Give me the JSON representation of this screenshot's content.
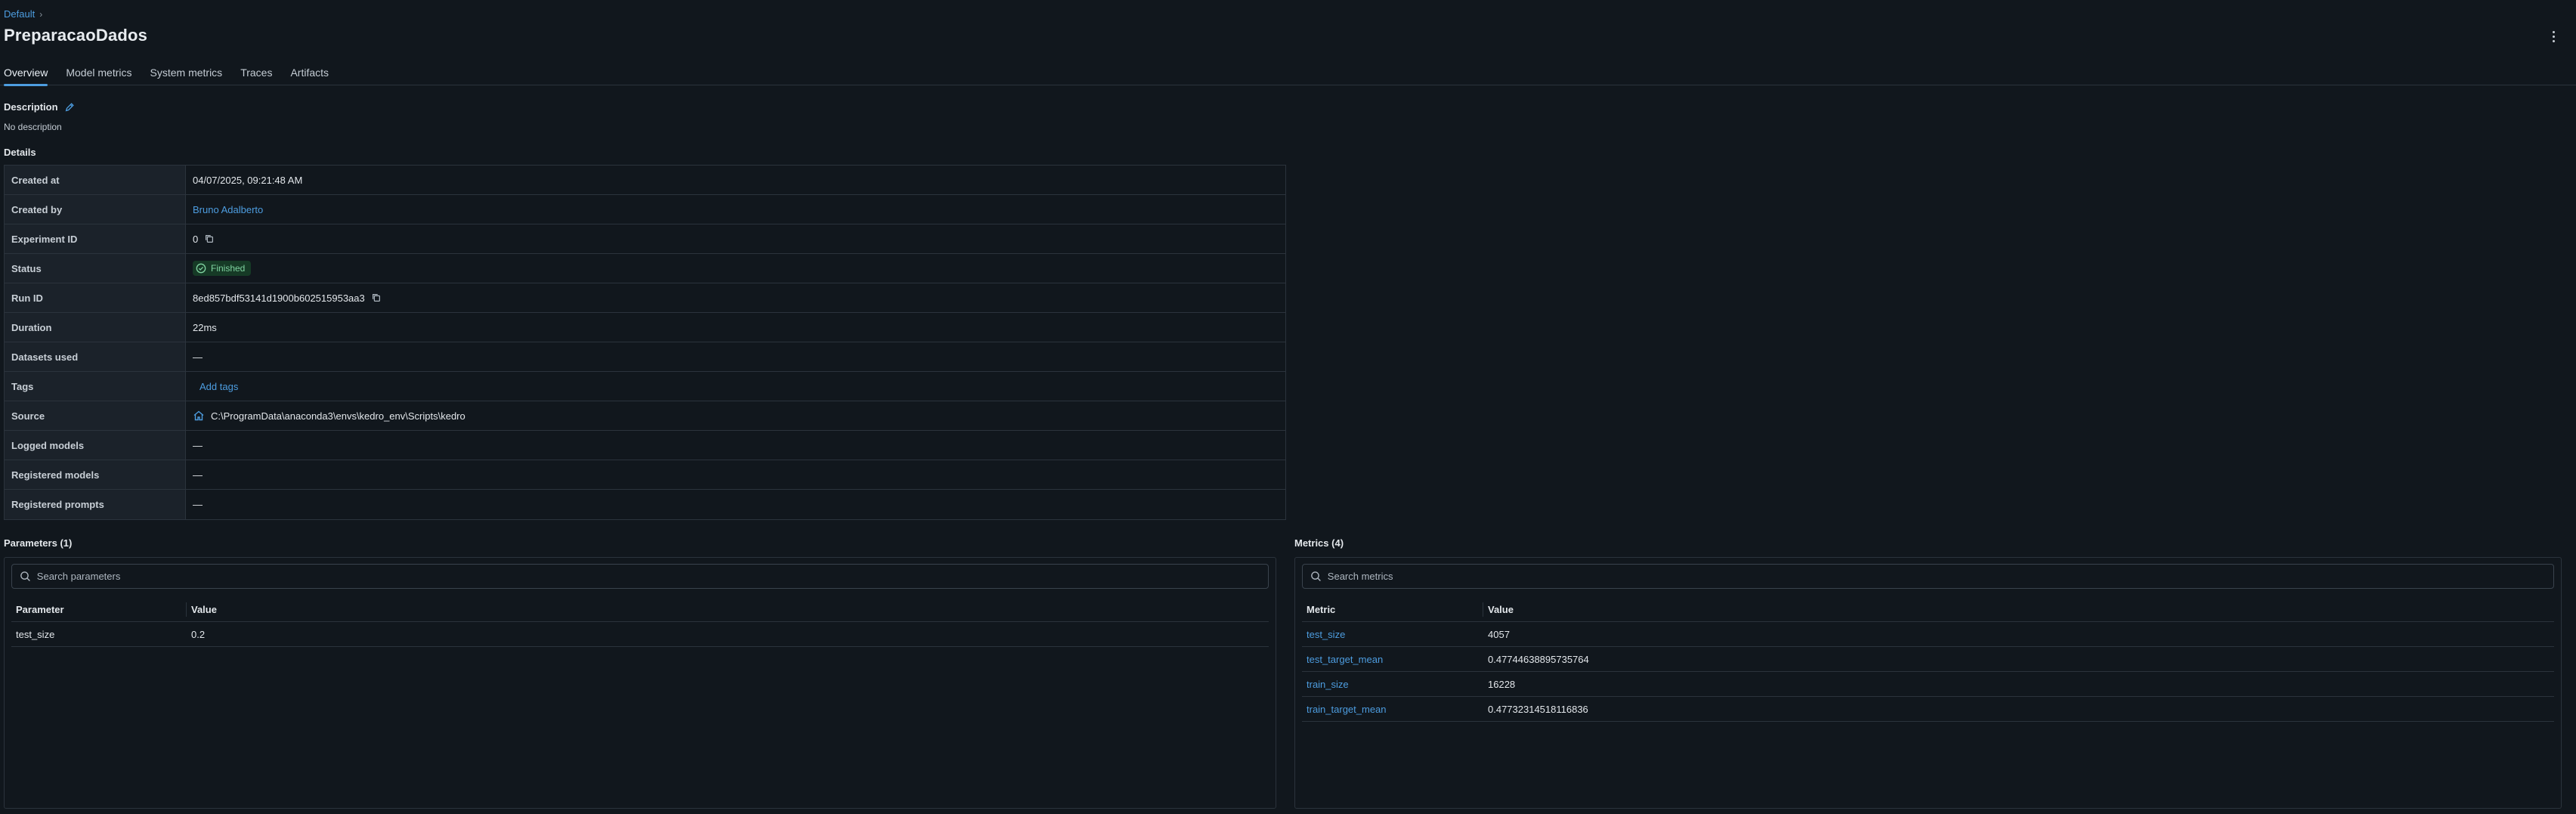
{
  "breadcrumb": {
    "item": "Default",
    "separator": "›"
  },
  "header": {
    "title": "PreparacaoDados"
  },
  "tabs": [
    {
      "label": "Overview",
      "active": true
    },
    {
      "label": "Model metrics",
      "active": false
    },
    {
      "label": "System metrics",
      "active": false
    },
    {
      "label": "Traces",
      "active": false
    },
    {
      "label": "Artifacts",
      "active": false
    }
  ],
  "description": {
    "label": "Description",
    "value": "No description"
  },
  "details": {
    "label": "Details",
    "rows": [
      {
        "key": "Created at",
        "value": "04/07/2025, 09:21:48 AM"
      },
      {
        "key": "Created by",
        "value": "Bruno Adalberto"
      },
      {
        "key": "Experiment ID",
        "value": "0"
      },
      {
        "key": "Status",
        "value": "Finished"
      },
      {
        "key": "Run ID",
        "value": "8ed857bdf53141d1900b602515953aa3"
      },
      {
        "key": "Duration",
        "value": "22ms"
      },
      {
        "key": "Datasets used",
        "value": "—"
      },
      {
        "key": "Tags",
        "value": "Add tags"
      },
      {
        "key": "Source",
        "value": "C:\\ProgramData\\anaconda3\\envs\\kedro_env\\Scripts\\kedro"
      },
      {
        "key": "Logged models",
        "value": "—"
      },
      {
        "key": "Registered models",
        "value": "—"
      },
      {
        "key": "Registered prompts",
        "value": "—"
      }
    ]
  },
  "parameters": {
    "label": "Parameters (1)",
    "search_placeholder": "Search parameters",
    "columns": [
      "Parameter",
      "Value"
    ],
    "rows": [
      {
        "name": "test_size",
        "value": "0.2"
      }
    ]
  },
  "metrics": {
    "label": "Metrics (4)",
    "search_placeholder": "Search metrics",
    "columns": [
      "Metric",
      "Value"
    ],
    "rows": [
      {
        "name": "test_size",
        "value": "4057"
      },
      {
        "name": "test_target_mean",
        "value": "0.47744638895735764"
      },
      {
        "name": "train_size",
        "value": "16228"
      },
      {
        "name": "train_target_mean",
        "value": "0.47732314518116836"
      }
    ]
  },
  "colors": {
    "accent": "#4d9de0",
    "background": "#11171d",
    "status_success": "#7fd3a0"
  },
  "icons": [
    "edit-icon",
    "copy-icon",
    "check-circle-icon",
    "home-icon",
    "search-icon",
    "kebab-menu-icon"
  ]
}
